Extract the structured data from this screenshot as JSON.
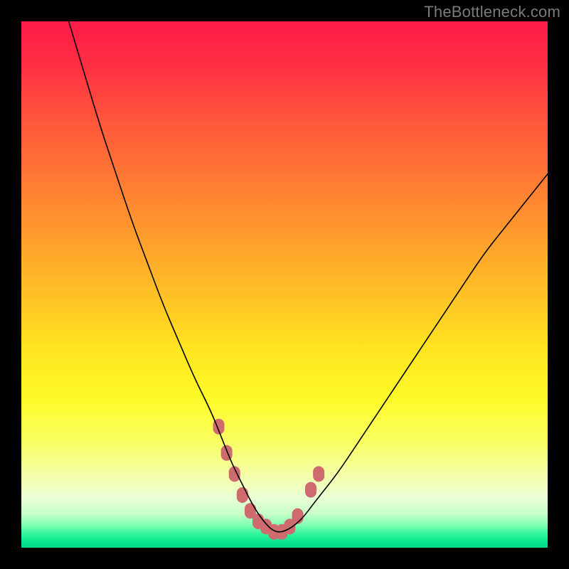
{
  "watermark": "TheBottleneck.com",
  "gradient": {
    "stops": [
      {
        "offset": 0.0,
        "color": "#ff1b48"
      },
      {
        "offset": 0.08,
        "color": "#ff2e44"
      },
      {
        "offset": 0.2,
        "color": "#ff5a3a"
      },
      {
        "offset": 0.35,
        "color": "#ff8a30"
      },
      {
        "offset": 0.5,
        "color": "#ffba27"
      },
      {
        "offset": 0.62,
        "color": "#ffe41f"
      },
      {
        "offset": 0.72,
        "color": "#fdfb2a"
      },
      {
        "offset": 0.8,
        "color": "#f9ff63"
      },
      {
        "offset": 0.86,
        "color": "#f4ffa6"
      },
      {
        "offset": 0.905,
        "color": "#eaffd5"
      },
      {
        "offset": 0.935,
        "color": "#c9ffc9"
      },
      {
        "offset": 0.958,
        "color": "#7dffb0"
      },
      {
        "offset": 0.975,
        "color": "#2cf59a"
      },
      {
        "offset": 0.99,
        "color": "#05e58e"
      },
      {
        "offset": 1.0,
        "color": "#00d985"
      }
    ]
  },
  "chart_data": {
    "type": "line",
    "title": "",
    "xlabel": "",
    "ylabel": "",
    "xlim": [
      0,
      100
    ],
    "ylim": [
      0,
      100
    ],
    "series": [
      {
        "name": "bottleneck-curve",
        "x": [
          9,
          12,
          15,
          18,
          21,
          24,
          27,
          30,
          33,
          36,
          38,
          40,
          42,
          44,
          46,
          48,
          50,
          53,
          56,
          60,
          64,
          68,
          72,
          76,
          80,
          84,
          88,
          92,
          96,
          100
        ],
        "y": [
          100,
          90,
          80,
          71,
          62,
          54,
          46,
          39,
          32,
          26,
          21,
          16,
          12,
          8,
          5,
          3,
          3,
          5,
          9,
          14,
          20,
          26,
          32,
          38,
          44,
          50,
          56,
          61,
          66,
          71
        ]
      }
    ],
    "markers": {
      "name": "highlight-dots",
      "color": "#cf6b6f",
      "points": [
        {
          "x": 37.5,
          "y": 23
        },
        {
          "x": 39.0,
          "y": 18
        },
        {
          "x": 40.5,
          "y": 14
        },
        {
          "x": 42.0,
          "y": 10
        },
        {
          "x": 43.5,
          "y": 7
        },
        {
          "x": 45.0,
          "y": 5
        },
        {
          "x": 46.5,
          "y": 4
        },
        {
          "x": 48.0,
          "y": 3
        },
        {
          "x": 49.5,
          "y": 3
        },
        {
          "x": 51.0,
          "y": 4
        },
        {
          "x": 52.5,
          "y": 6
        },
        {
          "x": 55.0,
          "y": 11
        },
        {
          "x": 56.5,
          "y": 14
        }
      ]
    }
  }
}
